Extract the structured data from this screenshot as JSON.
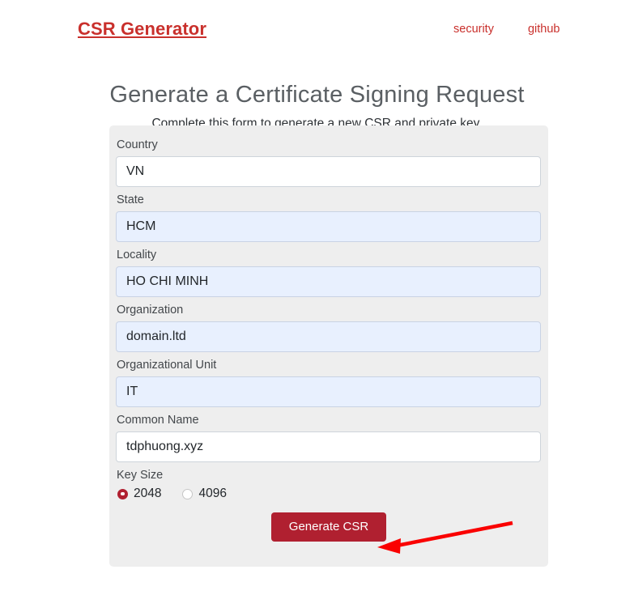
{
  "header": {
    "brand": "CSR Generator",
    "nav": [
      {
        "label": "security",
        "name": "nav-link-security"
      },
      {
        "label": "github",
        "name": "nav-link-github"
      }
    ]
  },
  "page": {
    "heading": "Generate a Certificate Signing Request",
    "subheading": "Complete this form to generate a new CSR and private key."
  },
  "form": {
    "fields": [
      {
        "label": "Country",
        "value": "VN",
        "autofilled": false
      },
      {
        "label": "State",
        "value": "HCM",
        "autofilled": true
      },
      {
        "label": "Locality",
        "value": "HO CHI MINH",
        "autofilled": true
      },
      {
        "label": "Organization",
        "value": "domain.ltd",
        "autofilled": true
      },
      {
        "label": "Organizational Unit",
        "value": "IT",
        "autofilled": true
      },
      {
        "label": "Common Name",
        "value": "tdphuong.xyz",
        "autofilled": false
      }
    ],
    "key_size": {
      "label": "Key Size",
      "options": [
        {
          "label": "2048",
          "selected": true
        },
        {
          "label": "4096",
          "selected": false
        }
      ]
    },
    "submit_label": "Generate CSR"
  },
  "colors": {
    "brand_red": "#c9302c",
    "button_red": "#b02030",
    "arrow_red": "#fa0000",
    "panel_bg": "#eeeeee",
    "autofill_bg": "#e8f0fe"
  },
  "annotation": {
    "arrow": "red-arrow-pointing-to-generate-csr-button"
  }
}
